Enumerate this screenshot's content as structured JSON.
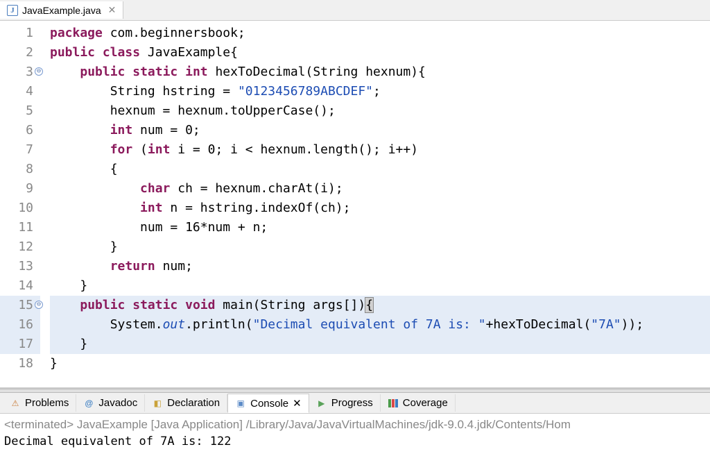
{
  "editor": {
    "tab": {
      "iconLetter": "J",
      "filename": "JavaExample.java",
      "closeGlyph": "✕"
    },
    "lines": [
      {
        "n": 1,
        "fold": false,
        "hl": false,
        "tokens": [
          [
            "kw",
            "package"
          ],
          [
            "",
            " com.beginnersbook;"
          ]
        ]
      },
      {
        "n": 2,
        "fold": false,
        "hl": false,
        "tokens": [
          [
            "kw",
            "public"
          ],
          [
            "",
            " "
          ],
          [
            "kw",
            "class"
          ],
          [
            "",
            " JavaExample{"
          ]
        ]
      },
      {
        "n": 3,
        "fold": true,
        "hl": false,
        "tokens": [
          [
            "",
            "    "
          ],
          [
            "kw",
            "public"
          ],
          [
            "",
            " "
          ],
          [
            "kw",
            "static"
          ],
          [
            "",
            " "
          ],
          [
            "kw",
            "int"
          ],
          [
            "",
            " hexToDecimal(String hexnum){"
          ]
        ]
      },
      {
        "n": 4,
        "fold": false,
        "hl": false,
        "tokens": [
          [
            "",
            "        String hstring = "
          ],
          [
            "str",
            "\"0123456789ABCDEF\""
          ],
          [
            "",
            ";"
          ]
        ]
      },
      {
        "n": 5,
        "fold": false,
        "hl": false,
        "tokens": [
          [
            "",
            "        hexnum = hexnum.toUpperCase();"
          ]
        ]
      },
      {
        "n": 6,
        "fold": false,
        "hl": false,
        "tokens": [
          [
            "",
            "        "
          ],
          [
            "kw",
            "int"
          ],
          [
            "",
            " num = 0;"
          ]
        ]
      },
      {
        "n": 7,
        "fold": false,
        "hl": false,
        "tokens": [
          [
            "",
            "        "
          ],
          [
            "kw",
            "for"
          ],
          [
            "",
            " ("
          ],
          [
            "kw",
            "int"
          ],
          [
            "",
            " i = 0; i < hexnum.length(); i++)"
          ]
        ]
      },
      {
        "n": 8,
        "fold": false,
        "hl": false,
        "tokens": [
          [
            "",
            "        {"
          ]
        ]
      },
      {
        "n": 9,
        "fold": false,
        "hl": false,
        "tokens": [
          [
            "",
            "            "
          ],
          [
            "kw",
            "char"
          ],
          [
            "",
            " ch = hexnum.charAt(i);"
          ]
        ]
      },
      {
        "n": 10,
        "fold": false,
        "hl": false,
        "tokens": [
          [
            "",
            "            "
          ],
          [
            "kw",
            "int"
          ],
          [
            "",
            " n = hstring.indexOf(ch);"
          ]
        ]
      },
      {
        "n": 11,
        "fold": false,
        "hl": false,
        "tokens": [
          [
            "",
            "            num = 16*num + n;"
          ]
        ]
      },
      {
        "n": 12,
        "fold": false,
        "hl": false,
        "tokens": [
          [
            "",
            "        }"
          ]
        ]
      },
      {
        "n": 13,
        "fold": false,
        "hl": false,
        "tokens": [
          [
            "",
            "        "
          ],
          [
            "kw",
            "return"
          ],
          [
            "",
            " num;"
          ]
        ]
      },
      {
        "n": 14,
        "fold": false,
        "hl": false,
        "tokens": [
          [
            "",
            "    }"
          ]
        ]
      },
      {
        "n": 15,
        "fold": true,
        "hl": true,
        "tokens": [
          [
            "",
            "    "
          ],
          [
            "kw",
            "public"
          ],
          [
            "",
            " "
          ],
          [
            "kw",
            "static"
          ],
          [
            "",
            " "
          ],
          [
            "kw",
            "void"
          ],
          [
            "",
            " main(String args[])"
          ],
          [
            "bracket-hl",
            "{"
          ]
        ]
      },
      {
        "n": 16,
        "fold": false,
        "hl": true,
        "tokens": [
          [
            "",
            "        System."
          ],
          [
            "it",
            "out"
          ],
          [
            "",
            ".println("
          ],
          [
            "str",
            "\"Decimal equivalent of 7A is: \""
          ],
          [
            "",
            "+hexToDecimal("
          ],
          [
            "str",
            "\"7A\""
          ],
          [
            "",
            "));"
          ]
        ]
      },
      {
        "n": 17,
        "fold": false,
        "hl": true,
        "tokens": [
          [
            "",
            "    }"
          ]
        ]
      },
      {
        "n": 18,
        "fold": false,
        "hl": false,
        "tokens": [
          [
            "",
            "}"
          ]
        ]
      }
    ],
    "foldGlyph": "⊖"
  },
  "bottomTabs": {
    "problems": "Problems",
    "javadoc": "Javadoc",
    "declaration": "Declaration",
    "console": "Console",
    "progress": "Progress",
    "coverage": "Coverage",
    "closeGlyph": "✕",
    "atGlyph": "@"
  },
  "console": {
    "termLine": "<terminated> JavaExample [Java Application] /Library/Java/JavaVirtualMachines/jdk-9.0.4.jdk/Contents/Hom",
    "output": "Decimal equivalent of 7A is: 122"
  }
}
